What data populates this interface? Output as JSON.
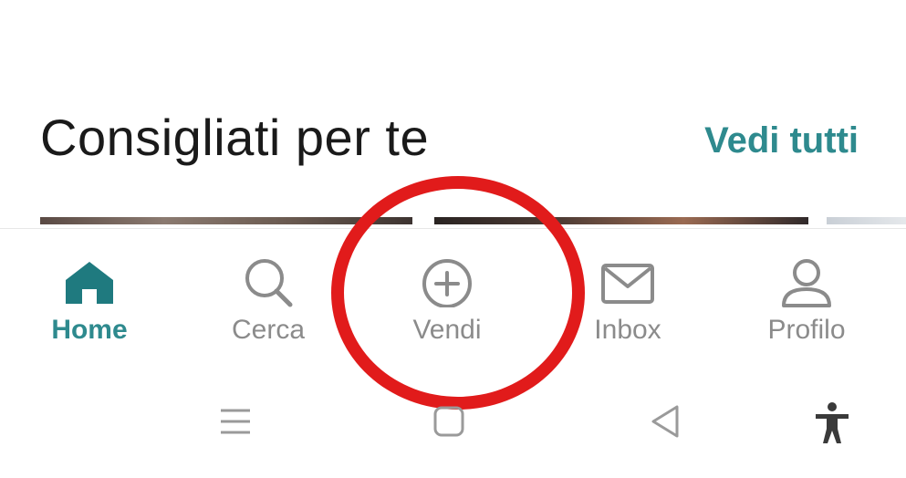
{
  "section": {
    "title": "Consigliati per te",
    "see_all": "Vedi tutti"
  },
  "bottom_nav": {
    "items": [
      {
        "label": "Home",
        "icon": "home-icon",
        "active": true
      },
      {
        "label": "Cerca",
        "icon": "search-icon",
        "active": false
      },
      {
        "label": "Vendi",
        "icon": "plus-circle-icon",
        "active": false
      },
      {
        "label": "Inbox",
        "icon": "mail-icon",
        "active": false
      },
      {
        "label": "Profilo",
        "icon": "user-icon",
        "active": false
      }
    ]
  },
  "annotation": {
    "highlight": "Vendi",
    "color": "#e11b1b"
  },
  "system_bar": {
    "icons": [
      "recent-apps-icon",
      "home-square-icon",
      "back-triangle-icon",
      "accessibility-icon"
    ]
  },
  "colors": {
    "accent": "#2e8a8e",
    "inactive": "#8b8b8b",
    "title": "#1a1a1a",
    "highlight": "#e11b1b"
  }
}
